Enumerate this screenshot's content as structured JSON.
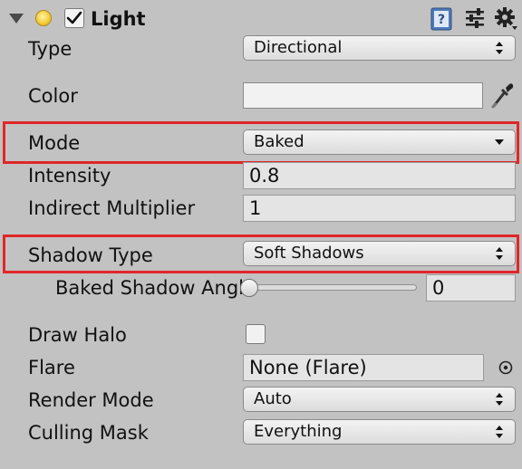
{
  "component": {
    "title": "Light",
    "enabled": true,
    "icons": [
      "foldout-arrow-icon",
      "light-bulb-icon",
      "help-book-icon",
      "presets-sliders-icon",
      "gear-icon"
    ]
  },
  "fields": {
    "type": {
      "label": "Type",
      "value": "Directional"
    },
    "color": {
      "label": "Color",
      "value": "#f2f2f2"
    },
    "mode": {
      "label": "Mode",
      "value": "Baked"
    },
    "intensity": {
      "label": "Intensity",
      "value": "0.8"
    },
    "indirect_multiplier": {
      "label": "Indirect Multiplier",
      "value": "1"
    },
    "shadow_type": {
      "label": "Shadow Type",
      "value": "Soft Shadows"
    },
    "baked_shadow_angle": {
      "label": "Baked Shadow Angl",
      "value": "0",
      "slider_fraction": 0
    },
    "draw_halo": {
      "label": "Draw Halo",
      "checked": false
    },
    "flare": {
      "label": "Flare",
      "value": "None (Flare)"
    },
    "render_mode": {
      "label": "Render Mode",
      "value": "Auto"
    },
    "culling_mask": {
      "label": "Culling Mask",
      "value": "Everything"
    }
  },
  "highlight_color": "#e0262a"
}
